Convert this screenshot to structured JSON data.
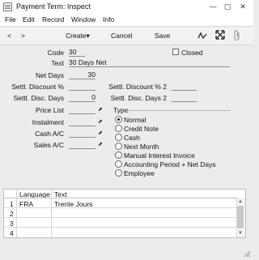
{
  "window": {
    "title": "Payment Term: Inspect",
    "minimize_glyph": "—",
    "maximize_glyph": "▢",
    "close_glyph": "✕"
  },
  "menu": [
    "File",
    "Edit",
    "Record",
    "Window",
    "Info"
  ],
  "toolbar": {
    "prev": "<",
    "next": ">",
    "create": "Create",
    "create_arrow": "▾",
    "cancel": "Cancel",
    "save": "Save"
  },
  "form": {
    "code_label": "Code",
    "code_value": "30",
    "closed_label": "Closed",
    "text_label": "Text",
    "text_value": "30 Days Net",
    "net_days_label": "Net Days",
    "net_days_value": "30",
    "settl_disc_label": "Settl. Discount %",
    "settl_disc_value": "",
    "settl_disc2_label": "Settl. Discount % 2",
    "settl_disc2_value": "",
    "settl_days_label": "Settl. Disc. Days",
    "settl_days_value": "0",
    "settl_days2_label": "Settl. Disc. Days 2",
    "settl_days2_value": "",
    "price_list_label": "Price List",
    "price_list_value": "",
    "instalment_label": "Instalment",
    "instalment_value": "",
    "cash_label": "Cash A/C",
    "cash_value": "",
    "sales_label": "Sales A/C",
    "sales_value": "",
    "type_label": "Type",
    "type_options": [
      "Normal",
      "Credit Note",
      "Cash",
      "Next Month",
      "Manual Interest Invoice",
      "Accounting Period + Net Days",
      "Employee"
    ],
    "type_selected": "Normal"
  },
  "grid": {
    "headers": [
      "Language",
      "Text"
    ],
    "rows": [
      {
        "num": "1",
        "language": "FRA",
        "text": "Trente Jours"
      },
      {
        "num": "2",
        "language": "",
        "text": ""
      },
      {
        "num": "3",
        "language": "",
        "text": ""
      },
      {
        "num": "4",
        "language": "",
        "text": ""
      }
    ]
  }
}
